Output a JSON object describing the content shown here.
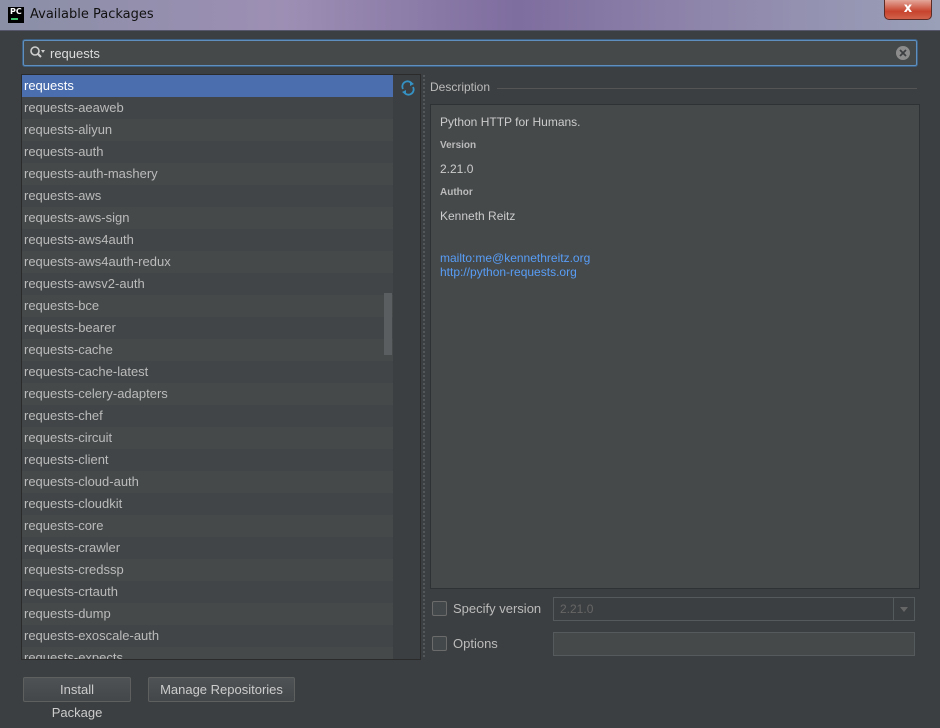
{
  "window": {
    "title": "Available Packages",
    "close_glyph": "x"
  },
  "search": {
    "value": "requests"
  },
  "packages": [
    "requests",
    "requests-aeaweb",
    "requests-aliyun",
    "requests-auth",
    "requests-auth-mashery",
    "requests-aws",
    "requests-aws-sign",
    "requests-aws4auth",
    "requests-aws4auth-redux",
    "requests-awsv2-auth",
    "requests-bce",
    "requests-bearer",
    "requests-cache",
    "requests-cache-latest",
    "requests-celery-adapters",
    "requests-chef",
    "requests-circuit",
    "requests-client",
    "requests-cloud-auth",
    "requests-cloudkit",
    "requests-core",
    "requests-crawler",
    "requests-credssp",
    "requests-crtauth",
    "requests-dump",
    "requests-exoscale-auth",
    "requests-expects"
  ],
  "selected_index": 0,
  "description": {
    "heading": "Description",
    "summary": "Python HTTP for Humans.",
    "version_label": "Version",
    "version": "2.21.0",
    "author_label": "Author",
    "author": "Kenneth Reitz",
    "email_link": "mailto:me@kennethreitz.org",
    "home_link": "http://python-requests.org"
  },
  "options": {
    "specify_version_label": "Specify version",
    "specify_version_value": "2.21.0",
    "options_label": "Options",
    "options_value": ""
  },
  "buttons": {
    "install": "Install Package",
    "manage": "Manage Repositories"
  },
  "colors": {
    "background": "#3c3f41",
    "selection": "#4b6eaf",
    "link": "#589df6",
    "refresh_icon": "#3592c4"
  },
  "icons": [
    "search-icon",
    "clear-icon",
    "refresh-icon",
    "chevron-down-icon",
    "pycharm-app-icon"
  ]
}
